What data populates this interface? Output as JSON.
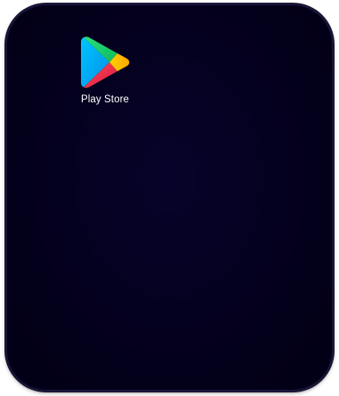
{
  "home_screen": {
    "apps": [
      {
        "label": "Play Store",
        "icon": "play-store-icon"
      }
    ]
  },
  "colors": {
    "wallpaper": "#03001a",
    "label_text": "#ffffff",
    "play_blue": "#00b6f6",
    "play_green": "#20d26a",
    "play_yellow": "#ffc400",
    "play_red": "#f03c4e"
  }
}
